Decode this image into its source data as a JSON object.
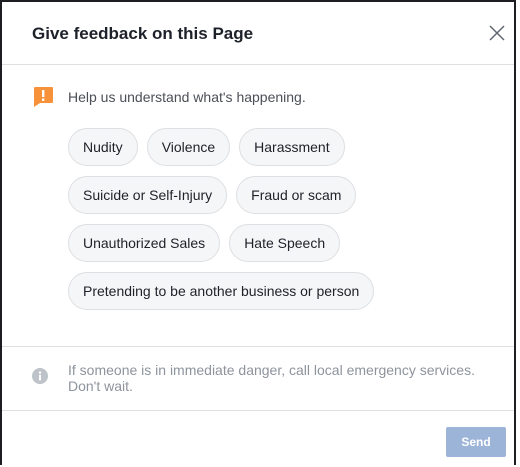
{
  "dialog": {
    "title": "Give feedback on this Page",
    "close_icon": "close-icon",
    "prompt": {
      "icon": "alert-icon",
      "text": "Help us understand what's happening."
    },
    "options": [
      [
        "Nudity",
        "Violence",
        "Harassment"
      ],
      [
        "Suicide or Self-Injury",
        "Fraud or scam"
      ],
      [
        "Unauthorized Sales",
        "Hate Speech"
      ],
      [
        "Pretending to be another business or person"
      ]
    ],
    "info": {
      "icon": "info-icon",
      "text": "If someone is in immediate danger, call local emergency services. Don't wait."
    },
    "send_label": "Send",
    "colors": {
      "accent_disabled": "#9cb4d8",
      "alert": "#f7923b",
      "chip_bg": "#f5f6f7",
      "divider": "#dddfe2"
    }
  }
}
